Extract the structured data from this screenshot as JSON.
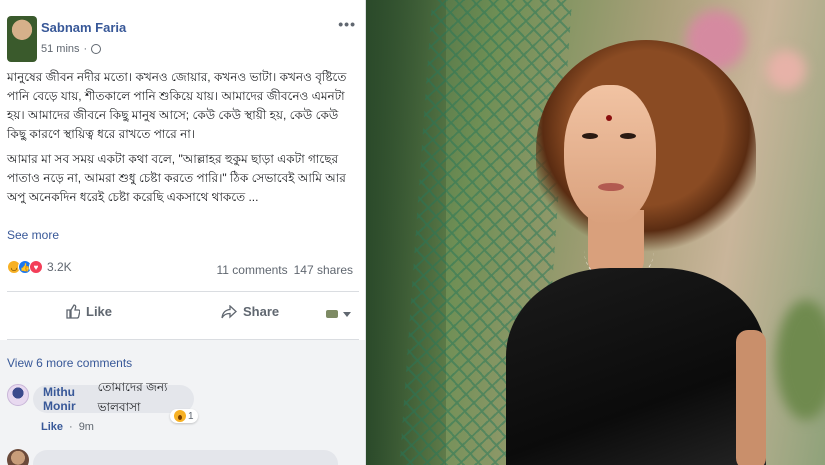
{
  "post": {
    "author": "Sabnam Faria",
    "time": "51 mins",
    "privacy_icon": "globe-icon",
    "paragraphs": [
      "মানুষের জীবন নদীর মতো। কখনও জোয়ার, কখনও ভাটা। কখনও বৃষ্টিতে পানি বেড়ে যায়, শীতকালে পানি শুকিয়ে যায়। আমাদের জীবনেও এমনটা হয়। আমাদের জীবনে কিছু মানুষ আসে; কেউ কেউ স্থায়ী হয়, কেউ কেউ কিছু কারণে স্থায়িত্ব ধরে রাখতে পারে না।",
      "আমার মা সব সময় একটা কথা বলে, \"আল্লাহর হুকুম ছাড়া একটা গাছের পাতাও নড়ে না, আমরা শুধু চেষ্টা করতে পারি।\" ঠিক সেভাবেই আমি আর অপু অনেকদিন ধরেই চেষ্টা করেছি একসাথে থাকতে ..."
    ],
    "see_more": "See more",
    "reaction_count": "3.2K",
    "comments_count": "11 comments",
    "shares_count": "147 shares",
    "like_label": "Like",
    "share_label": "Share"
  },
  "comments": {
    "view_more": "View 6 more comments",
    "items": [
      {
        "name": "Mithu Monir",
        "text": "তোমাদের জন্য ভালবাসা",
        "reaction_count": "1",
        "like_label": "Like",
        "time": "9m"
      }
    ]
  },
  "colors": {
    "link": "#385898",
    "muted": "#606770",
    "like_blue": "#1877f2",
    "love_red": "#f33e58",
    "sad_yellow": "#f7b125"
  }
}
